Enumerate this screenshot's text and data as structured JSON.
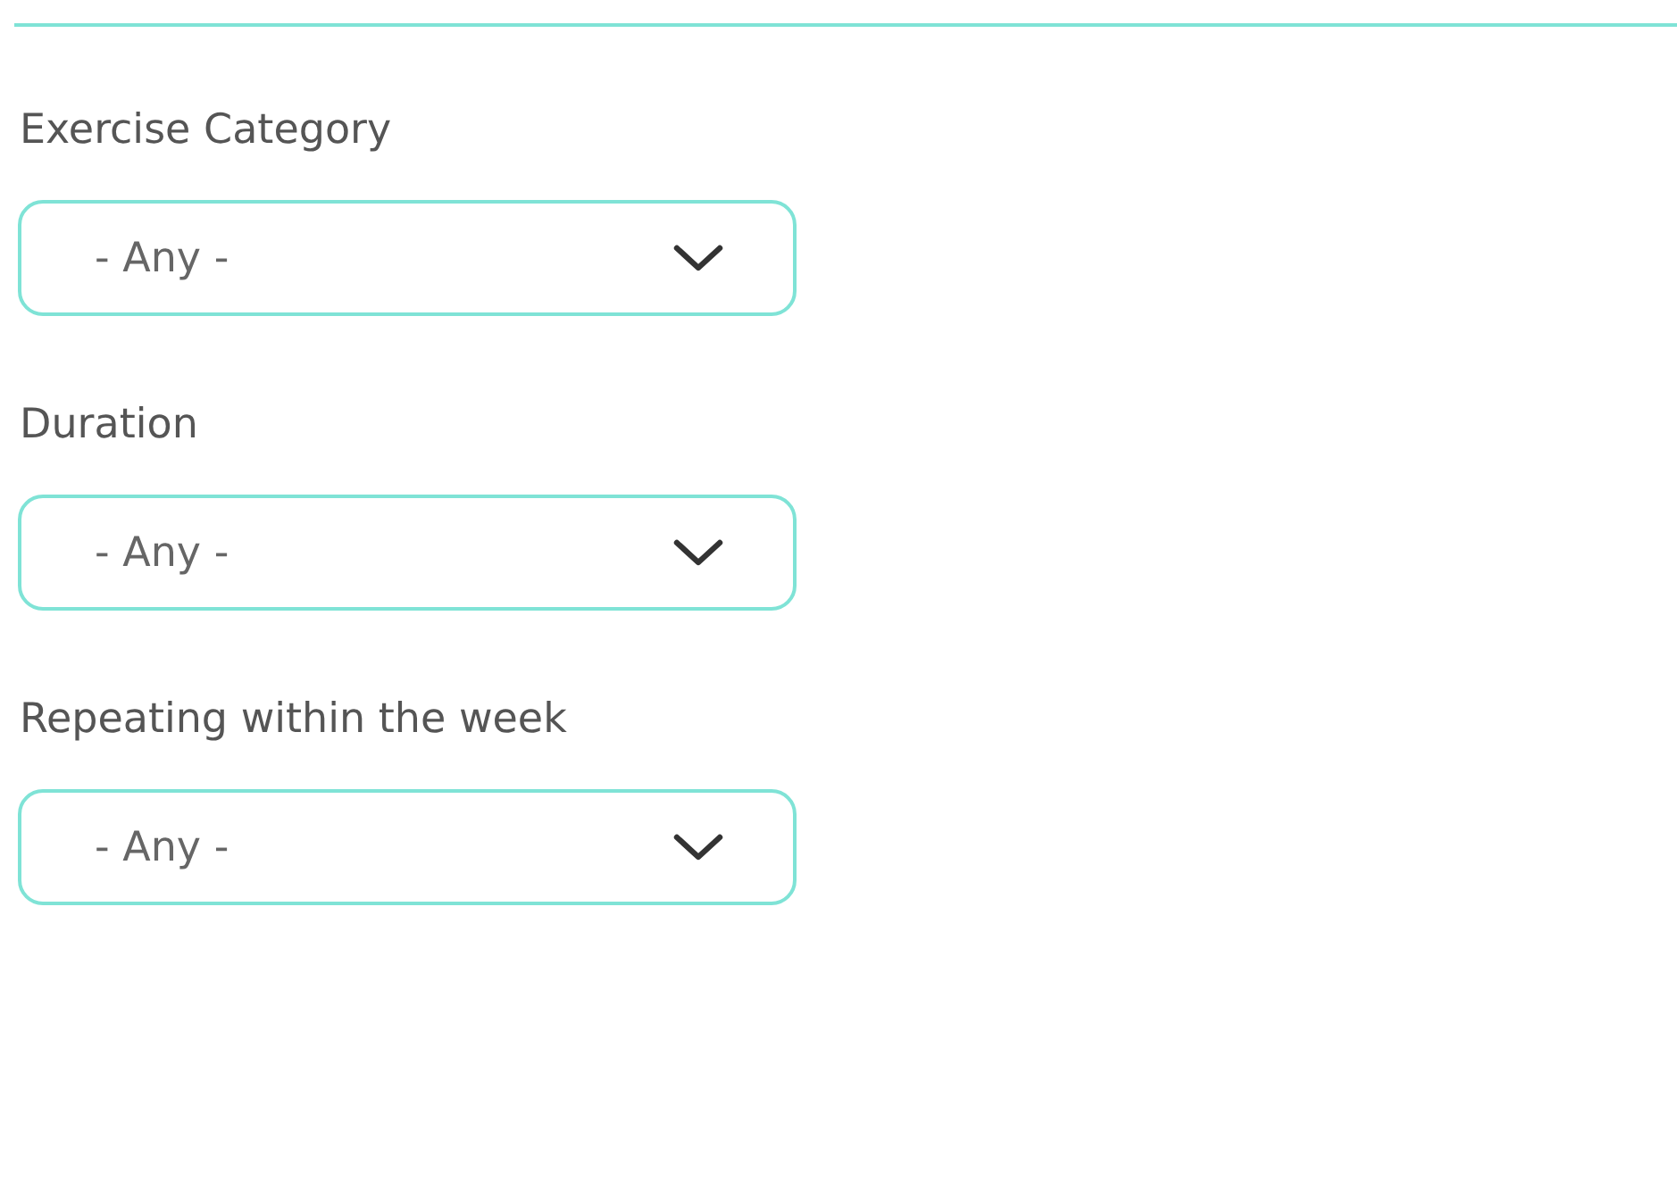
{
  "filters": [
    {
      "label": "Exercise Category",
      "value": "- Any -"
    },
    {
      "label": "Duration",
      "value": "- Any -"
    },
    {
      "label": "Repeating within the week",
      "value": "- Any -"
    }
  ]
}
